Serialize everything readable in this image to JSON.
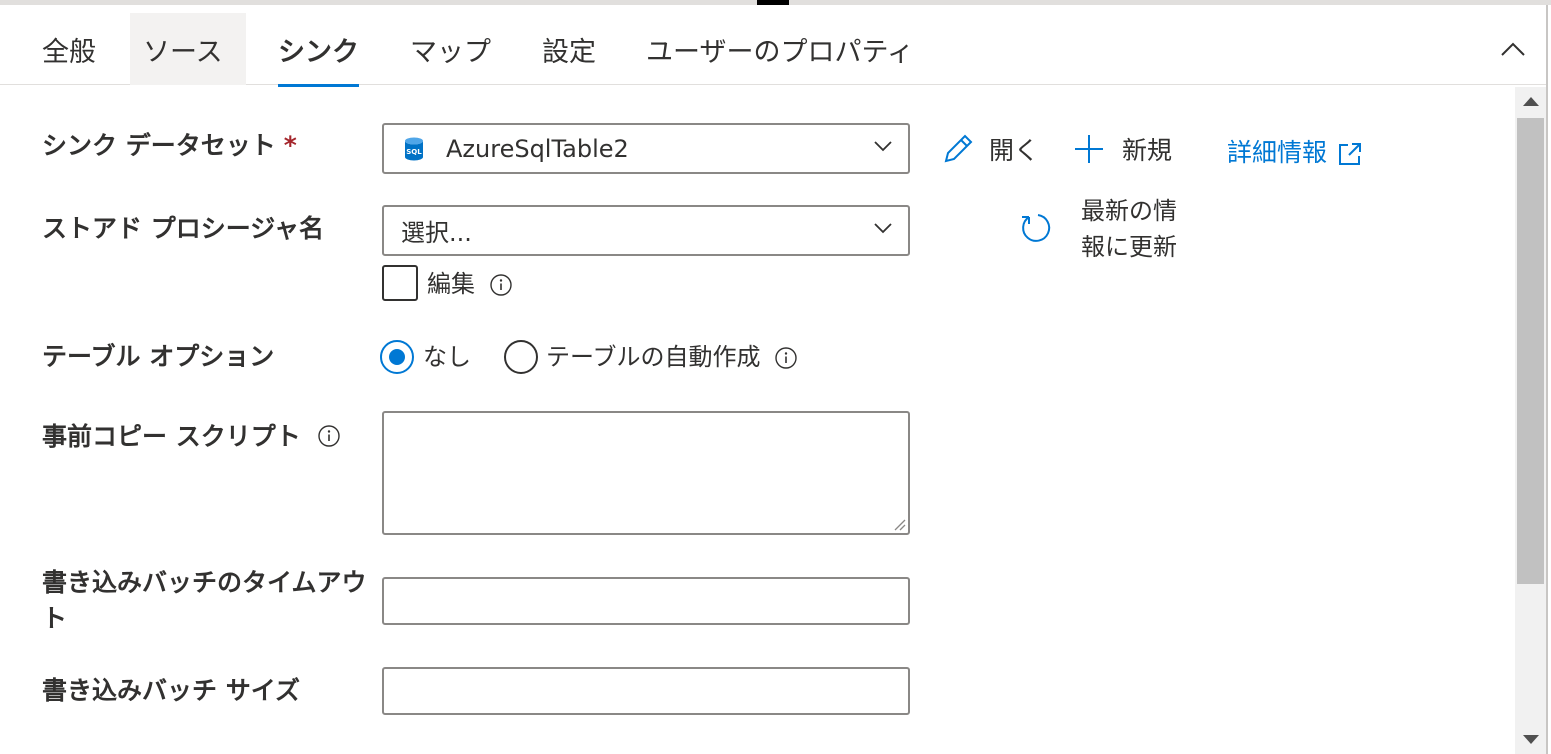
{
  "tabs": [
    {
      "label": "全般"
    },
    {
      "label": "ソース"
    },
    {
      "label": "シンク"
    },
    {
      "label": "マップ"
    },
    {
      "label": "設定"
    },
    {
      "label": "ユーザーのプロパティ"
    }
  ],
  "active_tab": "シンク",
  "colors": {
    "accent": "#0078d4",
    "required": "#a4262c",
    "border": "#8a8886"
  },
  "form": {
    "sink_dataset": {
      "label": "シンク データセット",
      "required_mark": "*",
      "value": "AzureSqlTable2",
      "icon": "sql-database-icon"
    },
    "actions": {
      "open": "開く",
      "new": "新規",
      "more_info": "詳細情報",
      "refresh_line1": "最新の情",
      "refresh_line2": "報に更新"
    },
    "stored_procedure": {
      "label": "ストアド プロシージャ名",
      "placeholder": "選択...",
      "edit_label": "編集"
    },
    "table_option": {
      "label": "テーブル オプション",
      "options": [
        "なし",
        "テーブルの自動作成"
      ],
      "selected": "なし"
    },
    "pre_copy_script": {
      "label": "事前コピー スクリプト",
      "value": ""
    },
    "write_batch_timeout": {
      "label_line1": "書き込みバッチのタイムアウ",
      "label_line2": "ト",
      "value": ""
    },
    "write_batch_size": {
      "label": "書き込みバッチ サイズ",
      "value": ""
    }
  }
}
